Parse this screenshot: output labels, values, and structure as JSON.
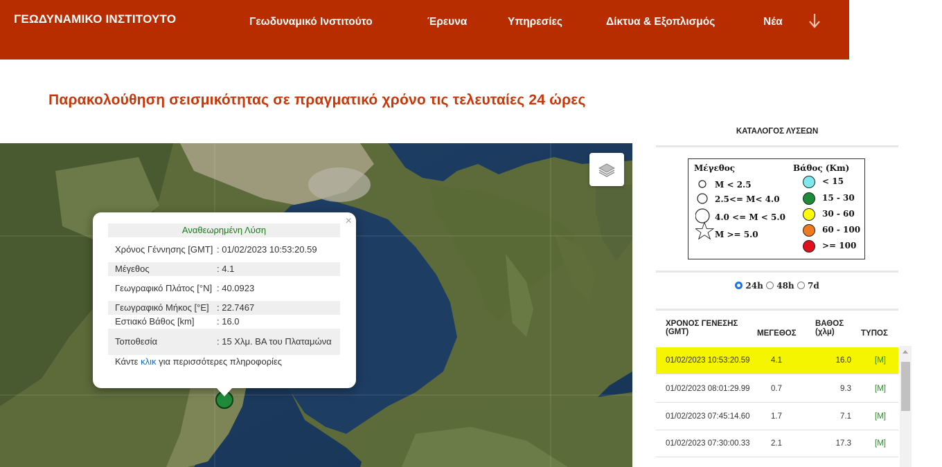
{
  "header": {
    "brand": "ΓΕΩΔΥΝΑΜΙΚΟ ΙΝΣΤΙΤΟΥΤΟ",
    "nav": [
      "Γεωδυναμικό Ινστιτούτο",
      "Έρευνα",
      "Υπηρεσίες",
      "Δίκτυα & Εξοπλισμός",
      "Νέα"
    ],
    "nav_more_icon": "arrow-down-icon"
  },
  "page_title": "Παρακολούθηση σεισμικότητας σε πραγματικό χρόνο τις τελευταίες 24 ώρες",
  "popup": {
    "title": "Αναθεωρημένη Λύση",
    "close": "×",
    "rows": [
      {
        "label": "Χρόνος Γέννησης [GMT]",
        "value": ": 01/02/2023 10:53:20.59"
      },
      {
        "label": "Μέγεθος",
        "value": ": 4.1"
      },
      {
        "label": "Γεωγραφικό Πλάτος [°N]",
        "value": ": 40.0923"
      },
      {
        "label": "Γεωγραφικό Μήκος [°E]",
        "value": ": 22.7467"
      },
      {
        "label": "Εστιακό Βάθος [km]",
        "value": ": 16.0"
      },
      {
        "label": "Τοποθεσία",
        "value": ": 15 Χλμ. ΒΑ του Πλαταμώνα"
      }
    ],
    "footer_pre": "Κάντε ",
    "footer_link": "κλικ",
    "footer_post": " για περισσότερες πληροφορίες"
  },
  "panel": {
    "title": "ΚΑΤΑΛΟΓΟΣ ΛΥΣΕΩΝ",
    "legend": {
      "magnitude_title": "Μέγεθος",
      "magnitude_items": [
        "M < 2.5",
        "2.5<= M< 4.0",
        "4.0 <= M < 5.0",
        "M >= 5.0"
      ],
      "depth_title": "Βάθος (Km)",
      "depth_items": [
        {
          "label": "< 15",
          "color": "#7fe8ef"
        },
        {
          "label": "15 - 30",
          "color": "#1f8a3a"
        },
        {
          "label": "30 - 60",
          "color": "#ffff00"
        },
        {
          "label": "60 - 100",
          "color": "#f07a20"
        },
        {
          "label": ">= 100",
          "color": "#e0101e"
        }
      ]
    },
    "periods": [
      "24h",
      "48h",
      "7d"
    ],
    "selected_period": "24h",
    "columns": [
      "ΧΡΟΝΟΣ ΓΕΝΕΣΗΣ (GMT)",
      "ΜΕΓΕΘΟΣ",
      "ΒΑΘΟΣ (χλμ)",
      "ΤΥΠΟΣ"
    ],
    "rows": [
      {
        "time": "01/02/2023 10:53:20.59",
        "mag": "4.1",
        "depth": "16.0",
        "type": "[M]"
      },
      {
        "time": "01/02/2023 08:01:29.99",
        "mag": "0.7",
        "depth": "9.3",
        "type": "[M]"
      },
      {
        "time": "01/02/2023 07:45:14.60",
        "mag": "1.7",
        "depth": "7.1",
        "type": "[M]"
      },
      {
        "time": "01/02/2023 07:30:00.33",
        "mag": "2.1",
        "depth": "17.3",
        "type": "[M]"
      }
    ]
  },
  "colors": {
    "header_bg": "#b82d00",
    "title_text": "#c8370a",
    "selected_row": "#f5f500",
    "quake_marker": "#1f8a3a"
  }
}
